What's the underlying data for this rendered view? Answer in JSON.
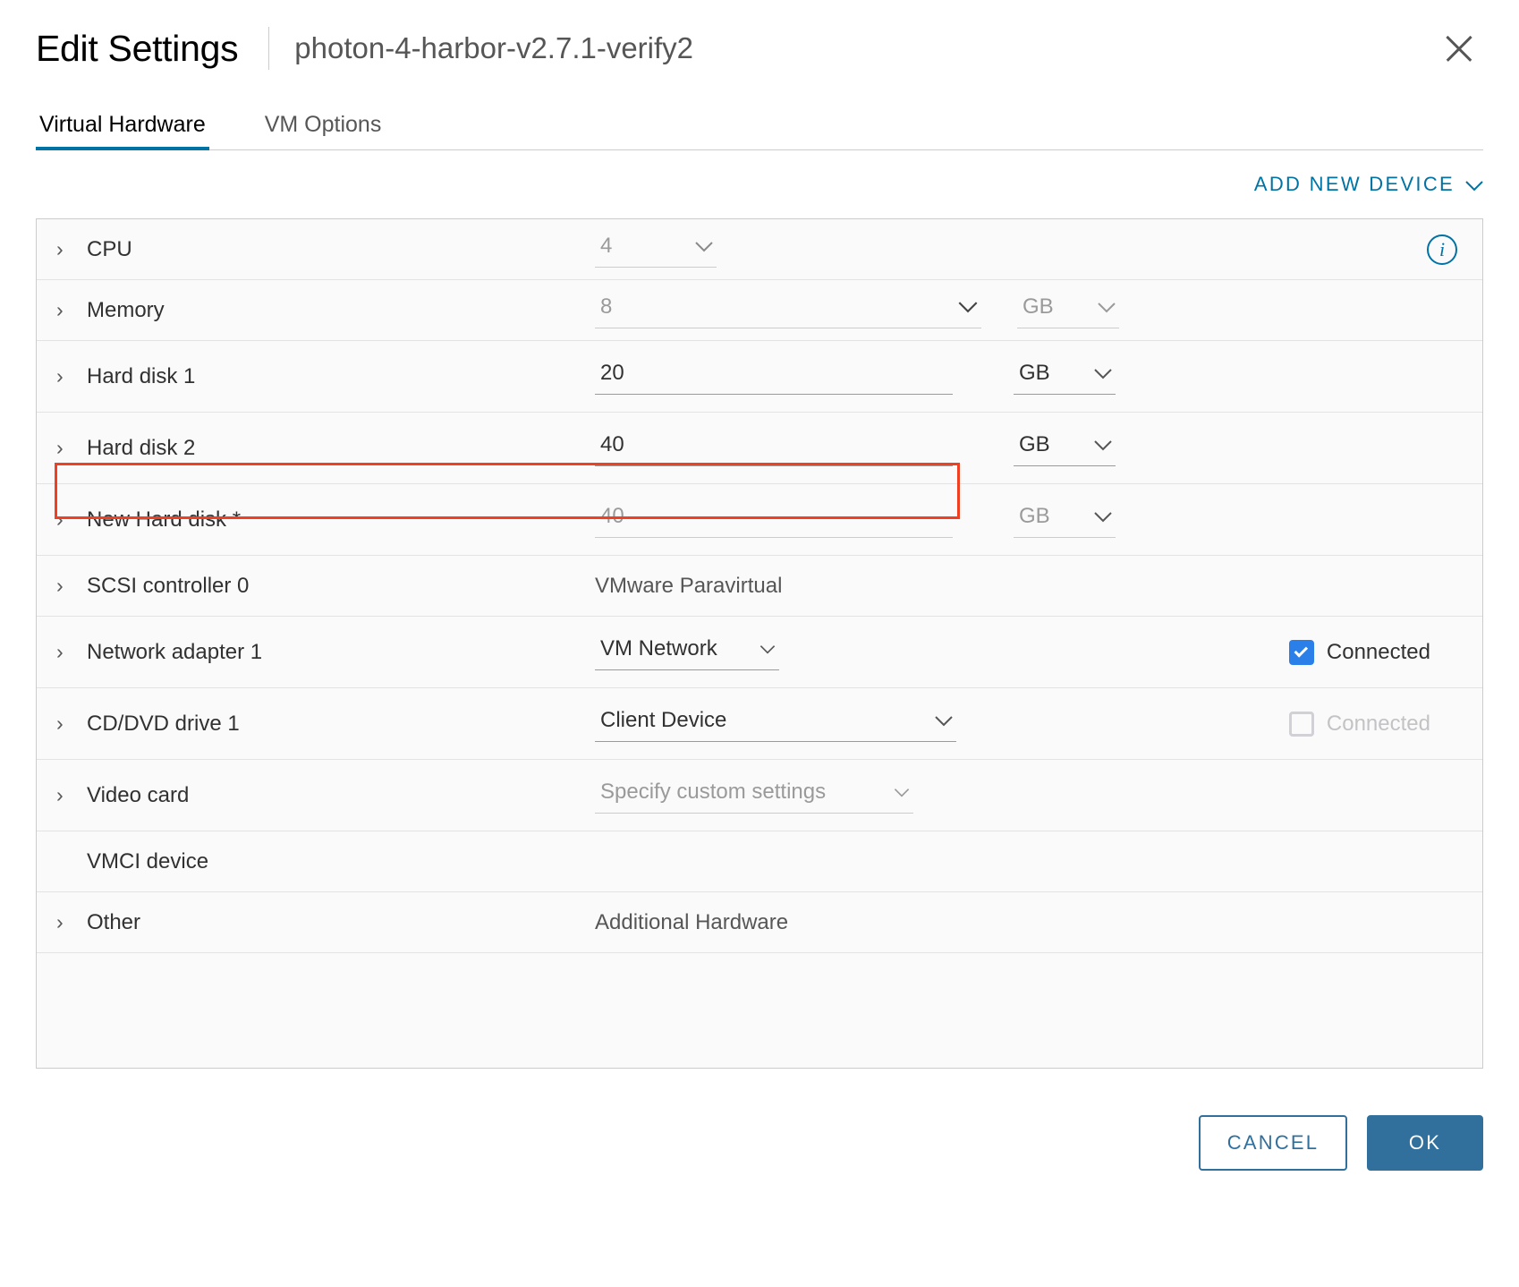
{
  "header": {
    "title": "Edit Settings",
    "vm_name": "photon-4-harbor-v2.7.1-verify2",
    "close_icon": "close-icon"
  },
  "tabs": [
    {
      "label": "Virtual Hardware",
      "active": true
    },
    {
      "label": "VM Options",
      "active": false
    }
  ],
  "toolbar": {
    "add_new_device": "ADD NEW DEVICE",
    "add_new_device_chevron": "⌄"
  },
  "colors": {
    "accent_blue": "#0072a3",
    "tab_underline": "#0072a3",
    "checkbox_checked": "#2a7fe8",
    "highlight_border": "#ef4023",
    "button_primary": "#31709c"
  },
  "devices": [
    {
      "label": "CPU",
      "value": "4",
      "unit": null,
      "disabled": true,
      "has_caret": true,
      "has_info_icon": true
    },
    {
      "label": "Memory",
      "value": "8",
      "unit": "GB",
      "disabled": true,
      "has_caret": true
    },
    {
      "label": "Hard disk 1",
      "value": "20",
      "unit": "GB",
      "disabled": false,
      "has_caret": true
    },
    {
      "label": "Hard disk 2",
      "value": "40",
      "unit": "GB",
      "disabled": false,
      "has_caret": true
    },
    {
      "label": "New Hard disk *",
      "value": "40",
      "unit": "GB",
      "disabled": true,
      "has_caret": true,
      "highlighted": true
    },
    {
      "label": "SCSI controller 0",
      "value": "VMware Paravirtual",
      "disabled": false,
      "has_caret": true
    },
    {
      "label": "Network adapter 1",
      "value": "VM Network",
      "disabled": false,
      "has_caret": true,
      "connected_label": "Connected",
      "connected_checked": true,
      "connected_disabled": false
    },
    {
      "label": "CD/DVD drive 1",
      "value": "Client Device",
      "disabled": false,
      "has_caret": true,
      "connected_label": "Connected",
      "connected_checked": false,
      "connected_disabled": true
    },
    {
      "label": "Video card",
      "value": "Specify custom settings",
      "disabled": true,
      "has_caret": true
    },
    {
      "label": "VMCI device",
      "value": "",
      "disabled": false,
      "has_caret": false
    },
    {
      "label": "Other",
      "value": "Additional Hardware",
      "disabled": false,
      "has_caret": true
    }
  ],
  "footer": {
    "cancel_label": "CANCEL",
    "ok_label": "OK"
  },
  "glyphs": {
    "caret_right": "›",
    "chevron_down": "⌄"
  }
}
